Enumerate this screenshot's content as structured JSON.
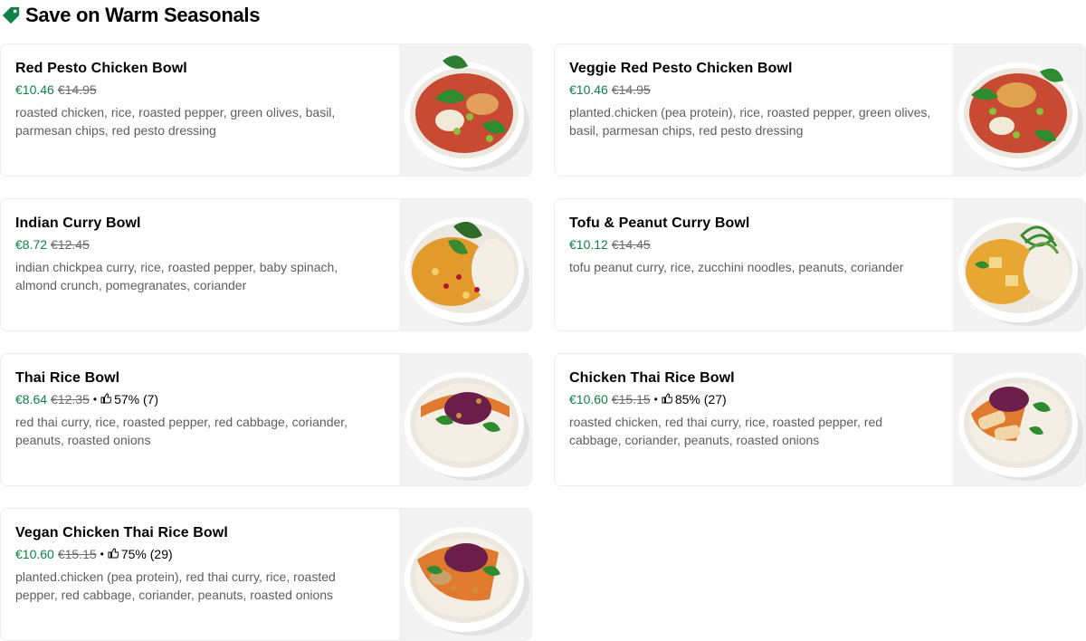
{
  "section": {
    "title": "Save on Warm Seasonals",
    "icon": "tag-icon"
  },
  "items": [
    {
      "title": "Red Pesto Chicken Bowl",
      "price_new": "€10.46",
      "price_old": "€14.95",
      "rating": "",
      "description": "roasted chicken, rice, roasted pepper, green olives, basil, parmesan chips, red pesto dressing"
    },
    {
      "title": "Veggie Red Pesto Chicken Bowl",
      "price_new": "€10.46",
      "price_old": "€14.95",
      "rating": "",
      "description": "planted.chicken (pea protein), rice, roasted pepper, green olives, basil, parmesan chips, red pesto dressing"
    },
    {
      "title": "Indian Curry Bowl",
      "price_new": "€8.72",
      "price_old": "€12.45",
      "rating": "",
      "description": "indian chickpea curry, rice, roasted pepper, baby spinach, almond crunch, pomegranates, coriander"
    },
    {
      "title": "Tofu & Peanut Curry Bowl",
      "price_new": "€10.12",
      "price_old": "€14.45",
      "rating": "",
      "description": "tofu peanut curry, rice, zucchini noodles, peanuts, coriander"
    },
    {
      "title": "Thai Rice Bowl",
      "price_new": "€8.64",
      "price_old": "€12.35",
      "separator": "•",
      "rating": "57% (7)",
      "description": "red thai curry, rice, roasted pepper, red cabbage, coriander, peanuts, roasted onions"
    },
    {
      "title": "Chicken Thai Rice Bowl",
      "price_new": "€10.60",
      "price_old": "€15.15",
      "separator": "•",
      "rating": "85% (27)",
      "description": "roasted chicken, red thai curry, rice, roasted pepper, red cabbage, coriander, peanuts, roasted onions"
    },
    {
      "title": "Vegan Chicken Thai Rice Bowl",
      "price_new": "€10.60",
      "price_old": "€15.15",
      "separator": "•",
      "rating": "75% (29)",
      "description": "planted.chicken (pea protein), red thai curry, rice, roasted pepper, red cabbage, coriander, peanuts, roasted onions"
    }
  ],
  "colors": {
    "discount_price": "#0e8345",
    "tag_icon": "#0e8345",
    "old_price": "#6b6b6b",
    "description": "#5e5e5e"
  },
  "icons": {
    "rating": "thumbs-up-icon"
  }
}
